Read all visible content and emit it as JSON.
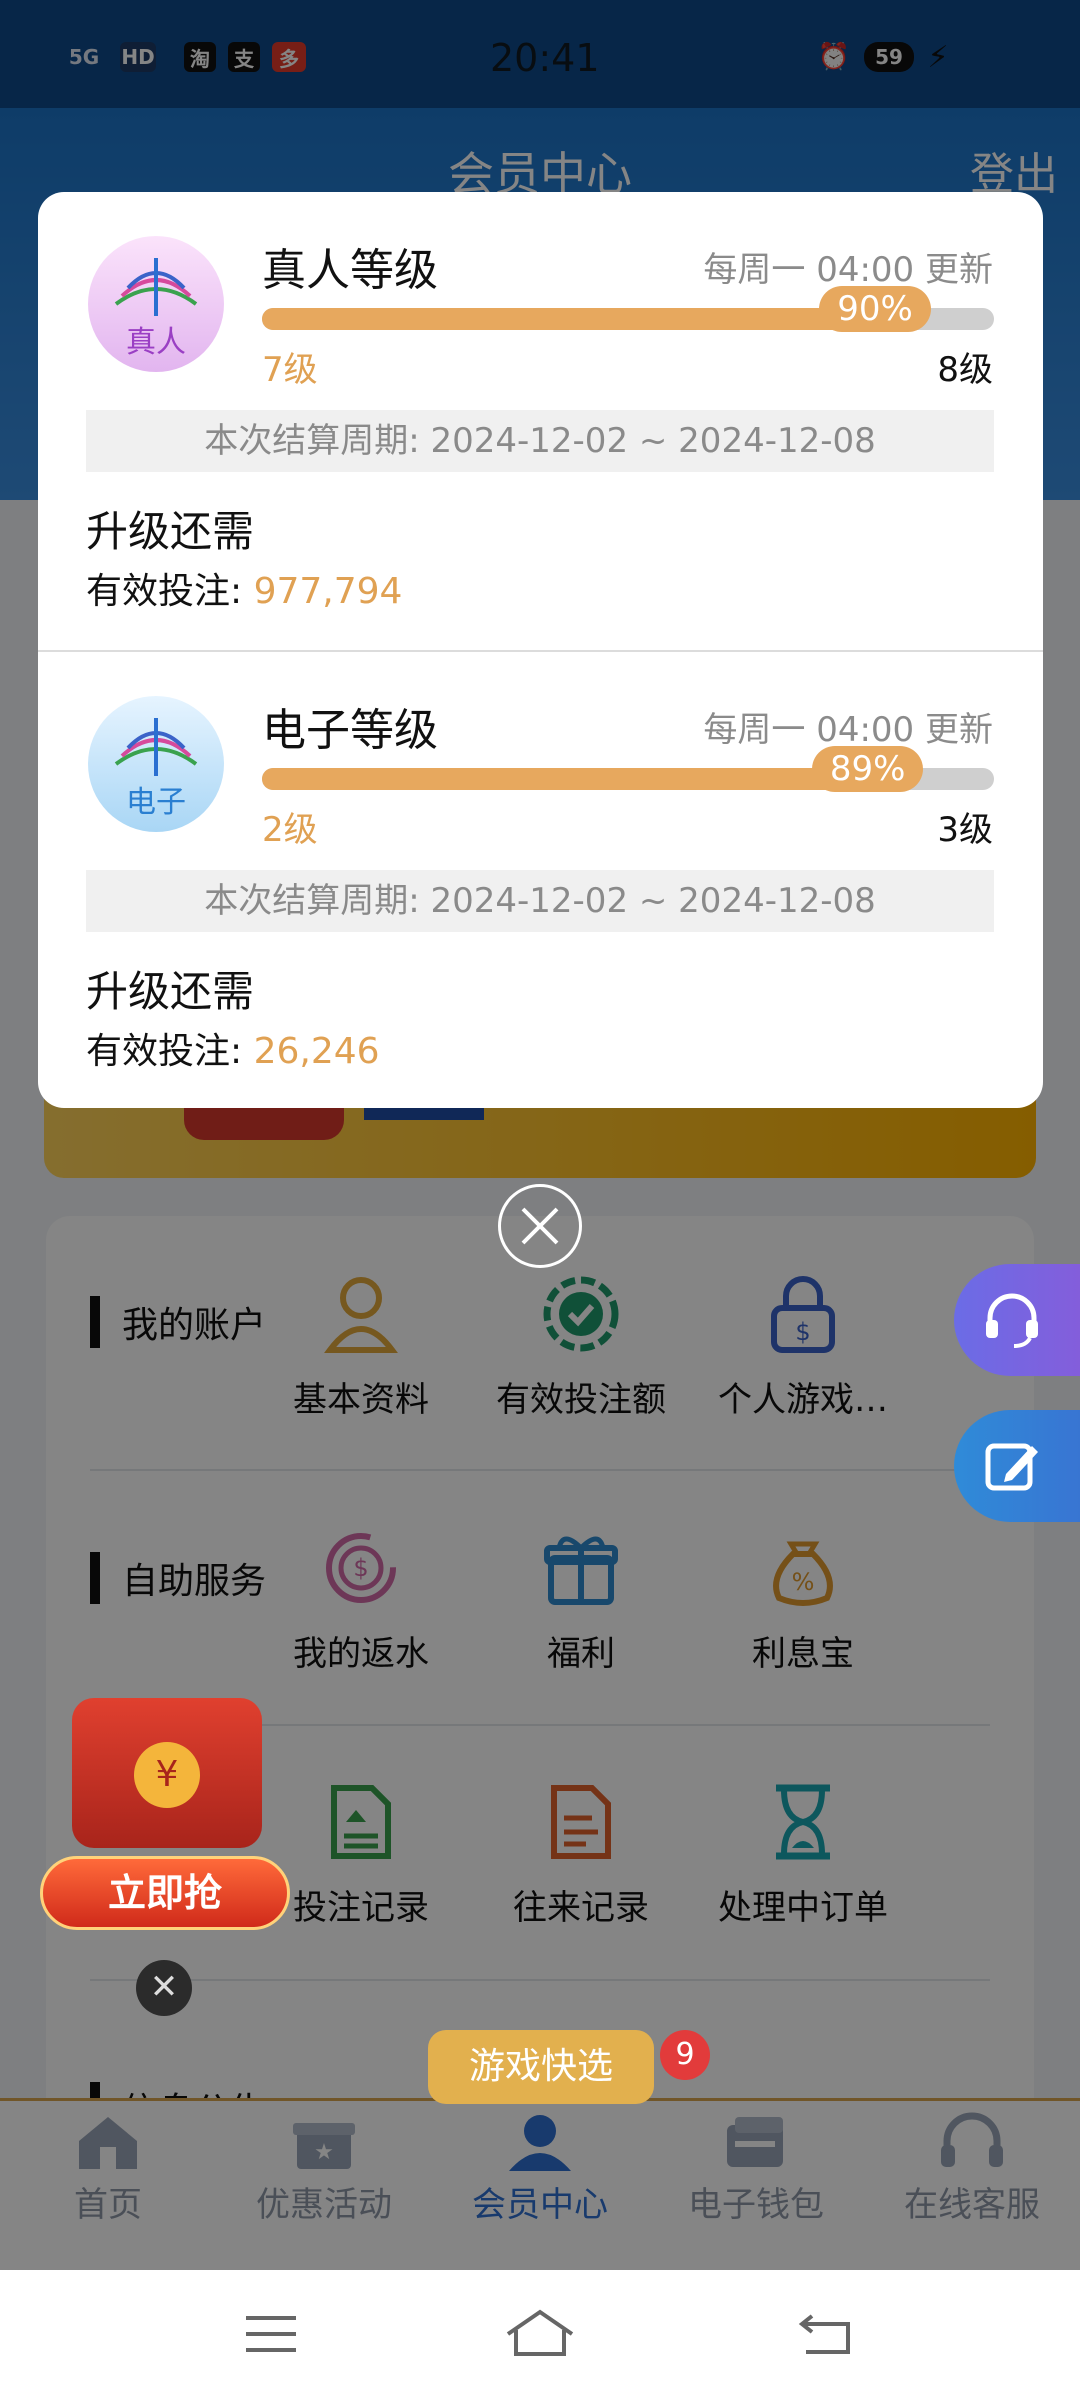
{
  "status_bar": {
    "time": "20:41",
    "battery": "59",
    "network": "5G",
    "hd": "HD"
  },
  "header": {
    "title": "会员中心",
    "logout": "登出"
  },
  "modal": {
    "sections": [
      {
        "avatar_text": "真人",
        "title": "真人等级",
        "update": "每周一 04:00 更新",
        "percent": "90%",
        "progress": 0.9,
        "current_level": "7级",
        "next_level": "8级",
        "period": "本次结算周期: 2024-12-02 ~ 2024-12-08",
        "need_label": "升级还需",
        "bet_label": "有效投注: ",
        "bet_value": "977,794"
      },
      {
        "avatar_text": "电子",
        "title": "电子等级",
        "update": "每周一 04:00 更新",
        "percent": "89%",
        "progress": 0.89,
        "current_level": "2级",
        "next_level": "3级",
        "period": "本次结算周期: 2024-12-02 ~ 2024-12-08",
        "need_label": "升级还需",
        "bet_label": "有效投注: ",
        "bet_value": "26,246"
      }
    ]
  },
  "menu": {
    "account": {
      "label": "我的账户",
      "items": [
        "基本资料",
        "有效投注额",
        "个人游戏…"
      ]
    },
    "self_service": {
      "label": "自助服务",
      "items": [
        "我的返水",
        "福利",
        "利息宝"
      ]
    },
    "records": {
      "items": [
        "投注记录",
        "往来记录",
        "处理中订单"
      ]
    },
    "next_section_label": "信息公告"
  },
  "promo": {
    "grab_label": "立即抢",
    "quick_pick": "游戏快选",
    "badge": "9"
  },
  "tabbar": {
    "tabs": [
      "首页",
      "优惠活动",
      "会员中心",
      "电子钱包",
      "在线客服"
    ]
  },
  "colors": {
    "accent_blue": "#2f6fd1",
    "gold": "#e0a153",
    "header_blue": "#1c74c8"
  }
}
